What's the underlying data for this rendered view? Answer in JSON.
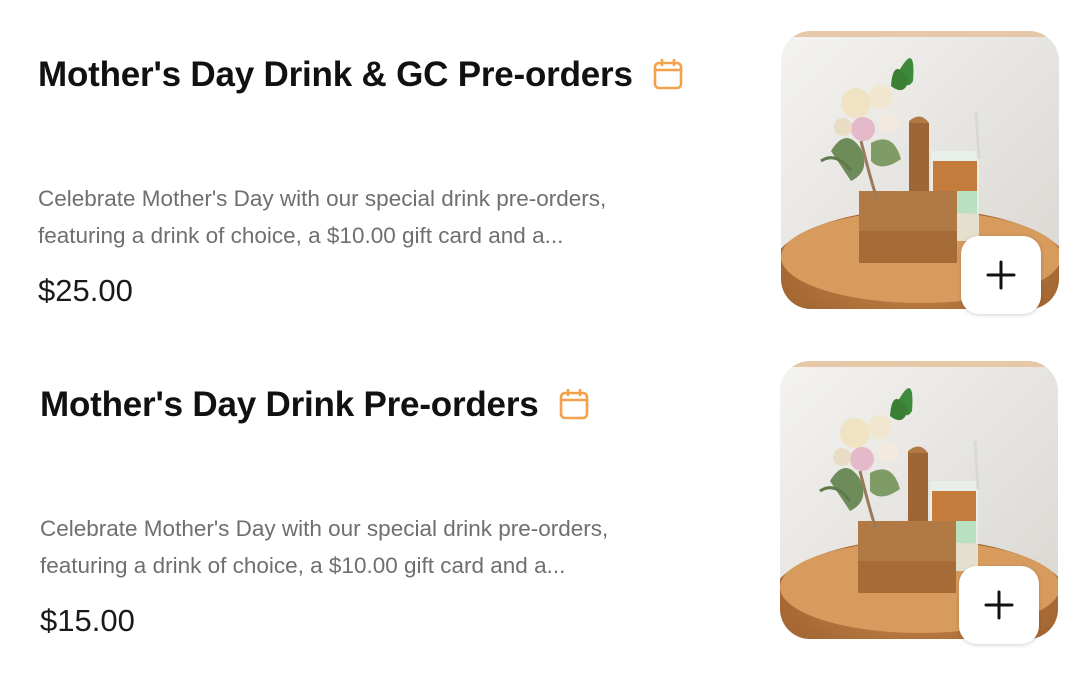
{
  "colors": {
    "accent": "#F5A04A",
    "title": "#111111",
    "description": "#6F6F6F",
    "price": "#1A1A1A"
  },
  "menu_items": [
    {
      "title": "Mother's Day Drink & GC Pre-orders",
      "title_icon": "calendar-icon",
      "description_line1": "Celebrate Mother's Day with our special drink pre-orders,",
      "description_line2": "featuring a drink of choice, a $10.00 gift card and a...",
      "price": "$25.00",
      "image": "flowers-and-iced-drink-photo",
      "add_icon": "plus-icon"
    },
    {
      "title": "Mother's Day Drink Pre-orders",
      "title_icon": "calendar-icon",
      "description_line1": "Celebrate Mother's Day with our special drink pre-orders,",
      "description_line2": "featuring a drink of choice, a $10.00 gift card and a...",
      "price": "$15.00",
      "image": "flowers-and-iced-drink-photo",
      "add_icon": "plus-icon"
    }
  ]
}
